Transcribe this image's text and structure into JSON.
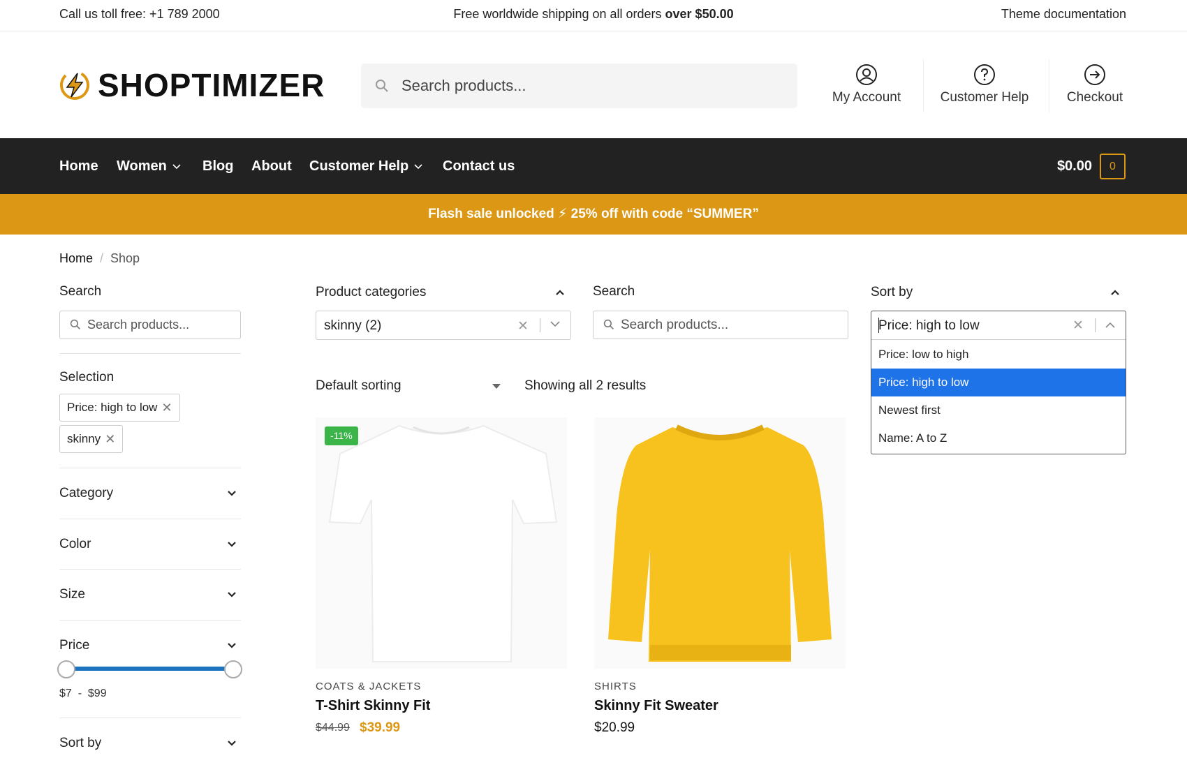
{
  "topbar": {
    "phone": "Call us toll free: +1 789 2000",
    "shipping_prefix": "Free worldwide shipping on all orders ",
    "shipping_bold": "over $50.00",
    "docs": "Theme documentation"
  },
  "header": {
    "logo": "SHOPTIMIZER",
    "search_placeholder": "Search products...",
    "account": "My Account",
    "help": "Customer Help",
    "checkout": "Checkout"
  },
  "nav": {
    "items": [
      "Home",
      "Women",
      "Blog",
      "About",
      "Customer Help",
      "Contact us"
    ],
    "cart_total": "$0.00",
    "cart_count": "0"
  },
  "flash": {
    "text": "Flash sale unlocked ⚡ 25% off with code “SUMMER”"
  },
  "breadcrumb": {
    "home": "Home",
    "separator": "/",
    "current": "Shop"
  },
  "sidebar": {
    "search_label": "Search",
    "search_placeholder": "Search products...",
    "selection_label": "Selection",
    "chips": [
      "Price: high to low",
      "skinny"
    ],
    "accordions": [
      "Category",
      "Color",
      "Size",
      "Price",
      "Sort by"
    ],
    "price_min": "$7",
    "price_dash": "-",
    "price_max": "$99",
    "price_range_min": 7,
    "price_range_max": 99
  },
  "filters": {
    "categories_label": "Product categories",
    "categories_value": "skinny  (2)",
    "search_label": "Search",
    "search_placeholder": "Search products...",
    "sort_label": "Sort by",
    "sort_value": "Price: high to low",
    "sort_options": [
      "Price: low to high",
      "Price: high to low",
      "Newest first",
      "Name: A to Z"
    ],
    "sort_selected_index": 1
  },
  "listing": {
    "sorting": "Default sorting",
    "results": "Showing all 2 results"
  },
  "products": [
    {
      "badge": "-11%",
      "category": "COATS & JACKETS",
      "name": "T-Shirt Skinny Fit",
      "price_old": "$44.99",
      "price_new": "$39.99"
    },
    {
      "category": "SHIRTS",
      "name": "Skinny Fit Sweater",
      "price": "$20.99"
    }
  ],
  "colors": {
    "accent": "#dc9814",
    "nav_bg": "#222222",
    "highlight": "#1e73e8",
    "badge": "#3bb54a"
  }
}
